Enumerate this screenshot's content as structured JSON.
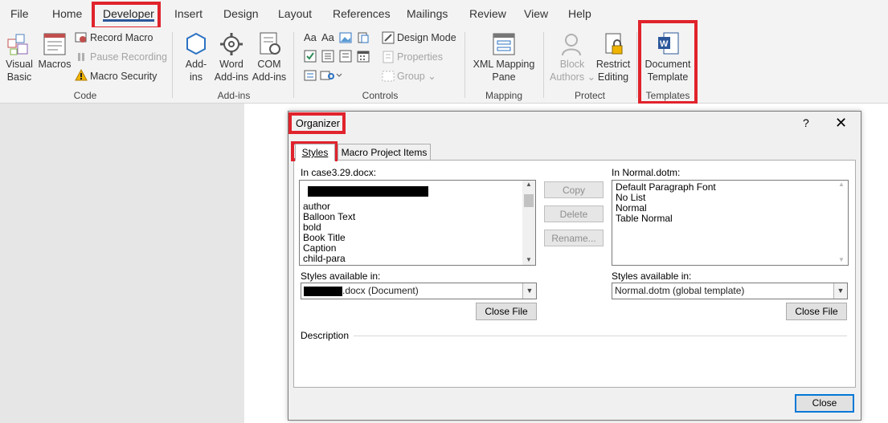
{
  "menu": {
    "tabs": [
      "File",
      "Home",
      "Developer",
      "Insert",
      "Design",
      "Layout",
      "References",
      "Mailings",
      "Review",
      "View",
      "Help"
    ]
  },
  "ribbon": {
    "code": {
      "visual_basic_l1": "Visual",
      "visual_basic_l2": "Basic",
      "macros": "Macros",
      "record_macro": "Record Macro",
      "pause_recording": "Pause Recording",
      "macro_security": "Macro Security",
      "group": "Code"
    },
    "addins": {
      "addins_l1": "Add-",
      "addins_l2": "ins",
      "word_l1": "Word",
      "word_l2": "Add-ins",
      "com_l1": "COM",
      "com_l2": "Add-ins",
      "group": "Add-ins"
    },
    "controls": {
      "design_mode": "Design Mode",
      "properties": "Properties",
      "group_btn": "Group",
      "group": "Controls",
      "aa1": "Aa",
      "aa2": "Aa"
    },
    "mapping": {
      "xml_l1": "XML Mapping",
      "xml_l2": "Pane",
      "group": "Mapping"
    },
    "protect": {
      "block_l1": "Block",
      "block_l2": "Authors",
      "restrict_l1": "Restrict",
      "restrict_l2": "Editing",
      "group": "Protect"
    },
    "templates": {
      "doc_l1": "Document",
      "doc_l2": "Template",
      "group": "Templates"
    }
  },
  "dialog": {
    "title": "Organizer",
    "help": "?",
    "close_icon": "✕",
    "tabs": [
      "Styles",
      "Macro Project Items"
    ],
    "left": {
      "label": "In case3.29.docx:",
      "items": [
        "author",
        "Balloon Text",
        "bold",
        "Book Title",
        "Caption",
        "child-para"
      ],
      "available_label": "Styles available in:",
      "available_value": ".docx (Document)",
      "close_file": "Close File"
    },
    "buttons": {
      "copy": "Copy",
      "delete": "Delete",
      "rename": "Rename..."
    },
    "right": {
      "label": "In Normal.dotm:",
      "items": [
        "Default Paragraph Font",
        "No List",
        "Normal",
        "Table Normal"
      ],
      "available_label": "Styles available in:",
      "available_value": "Normal.dotm (global template)",
      "close_file": "Close File"
    },
    "description_label": "Description",
    "close_button": "Close"
  },
  "colors": {
    "highlight": "#e0232c",
    "accent": "#2b579a"
  }
}
